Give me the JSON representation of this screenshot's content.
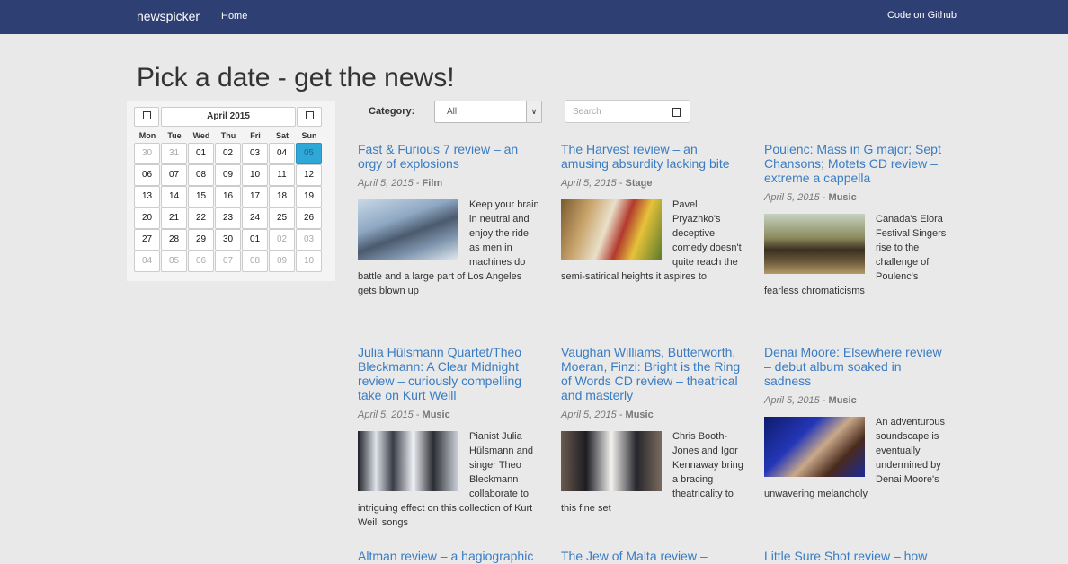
{
  "nav": {
    "brand": "newspicker",
    "home": "Home",
    "github": "Code on Github"
  },
  "page_title": "Pick a date - get the news!",
  "calendar": {
    "title": "April 2015",
    "weekdays": [
      "Mon",
      "Tue",
      "Wed",
      "Thu",
      "Fri",
      "Sat",
      "Sun"
    ],
    "weeks": [
      [
        "30",
        "31",
        "01",
        "02",
        "03",
        "04",
        "05"
      ],
      [
        "06",
        "07",
        "08",
        "09",
        "10",
        "11",
        "12"
      ],
      [
        "13",
        "14",
        "15",
        "16",
        "17",
        "18",
        "19"
      ],
      [
        "20",
        "21",
        "22",
        "23",
        "24",
        "25",
        "26"
      ],
      [
        "27",
        "28",
        "29",
        "30",
        "01",
        "02",
        "03"
      ],
      [
        "04",
        "05",
        "06",
        "07",
        "08",
        "09",
        "10"
      ]
    ],
    "selected": "05",
    "muted_leading": 2,
    "muted_trailing_after_index": 32
  },
  "filters": {
    "category_label": "Category:",
    "category_value": "All",
    "search_placeholder": "Search"
  },
  "articles": [
    {
      "title": "Fast & Furious 7 review – an orgy of explosions",
      "date": "April 5, 2015",
      "category": "Film",
      "summary": "Keep your brain in neutral and enjoy the ride as men in machines do battle and a large part of Los Angeles gets blown up",
      "thumb": "car"
    },
    {
      "title": "The Harvest review – an amusing absurdity lacking bite",
      "date": "April 5, 2015",
      "category": "Stage",
      "summary": "Pavel Pryazhko's deceptive comedy doesn't quite reach the semi-satirical heights it aspires to",
      "thumb": "stage"
    },
    {
      "title": "Poulenc: Mass in G major; Sept Chansons; Motets CD review – extreme a cappella",
      "date": "April 5, 2015",
      "category": "Music",
      "summary": "Canada's Elora Festival Singers rise to the challenge of Poulenc's fearless chromaticisms",
      "thumb": "choir"
    },
    {
      "title": "Julia Hülsmann Quartet/Theo Bleckmann: A Clear Midnight review – curiously compelling take on Kurt Weill",
      "date": "April 5, 2015",
      "category": "Music",
      "summary": "Pianist Julia Hülsmann and singer Theo Bleckmann collaborate to intriguing effect on this collection of Kurt Weill songs",
      "thumb": "band"
    },
    {
      "title": "Vaughan Williams, Butterworth, Moeran, Finzi: Bright is the Ring of Words CD review – theatrical and masterly",
      "date": "April 5, 2015",
      "category": "Music",
      "summary": "Chris Booth-Jones and Igor Kennaway bring a bracing theatricality to this fine set",
      "thumb": "men"
    },
    {
      "title": "Denai Moore: Elsewhere review – debut album soaked in sadness",
      "date": "April 5, 2015",
      "category": "Music",
      "summary": "An adventurous soundscape is eventually undermined by Denai Moore's unwavering melancholy",
      "thumb": "singer"
    },
    {
      "title": "Altman review – a hagiographic",
      "date": "",
      "category": "",
      "summary": "",
      "thumb": ""
    },
    {
      "title": "The Jew of Malta review –",
      "date": "",
      "category": "",
      "summary": "",
      "thumb": ""
    },
    {
      "title": "Little Sure Shot review – how",
      "date": "",
      "category": "",
      "summary": "",
      "thumb": ""
    }
  ]
}
